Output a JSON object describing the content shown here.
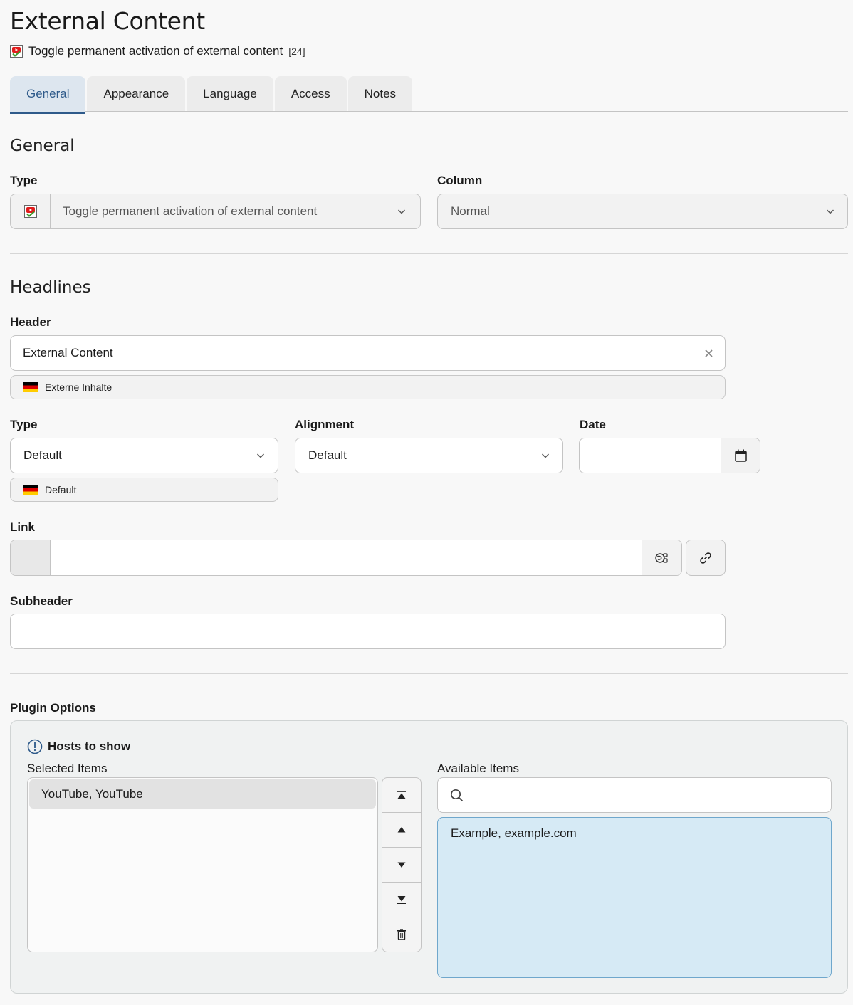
{
  "page": {
    "title": "External Content",
    "record_label": "Toggle permanent activation of external content",
    "record_uid": "[24]",
    "type_icon": "content-element-icon"
  },
  "tabs": [
    {
      "label": "General",
      "active": true
    },
    {
      "label": "Appearance",
      "active": false
    },
    {
      "label": "Language",
      "active": false
    },
    {
      "label": "Access",
      "active": false
    },
    {
      "label": "Notes",
      "active": false
    }
  ],
  "general": {
    "title": "General",
    "type_label": "Type",
    "type_value": "Toggle permanent activation of external content",
    "column_label": "Column",
    "column_value": "Normal"
  },
  "headlines": {
    "title": "Headlines",
    "header_label": "Header",
    "header_value": "External Content",
    "header_translation": "Externe Inhalte",
    "type_label": "Type",
    "type_value": "Default",
    "type_translation": "Default",
    "alignment_label": "Alignment",
    "alignment_value": "Default",
    "date_label": "Date",
    "date_value": "",
    "link_label": "Link",
    "link_value": "",
    "subheader_label": "Subheader",
    "subheader_value": ""
  },
  "plugin": {
    "title": "Plugin Options",
    "hosts_label": "Hosts to show",
    "selected_label": "Selected Items",
    "available_label": "Available Items",
    "search_placeholder": "",
    "selected_items": [
      "YouTube, YouTube"
    ],
    "available_items": [
      "Example, example.com"
    ]
  },
  "colors": {
    "accent": "#2e5a8a",
    "available_bg": "#d6eaf5",
    "available_border": "#6fa7cc"
  }
}
